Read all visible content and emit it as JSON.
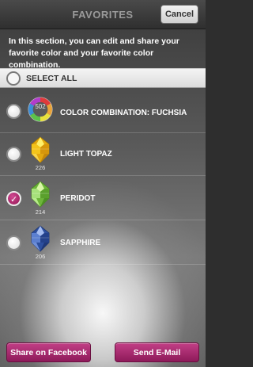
{
  "header": {
    "title": "FAVORITES",
    "cancel_label": "Cancel"
  },
  "intro_text": "In this section, you can edit and share your favorite color and your favorite color combination.",
  "select_all_label": "SELECT ALL",
  "items": [
    {
      "label": "COLOR COMBINATION: FUCHSIA",
      "code": "502",
      "checked": false,
      "icon": "color-wheel-icon"
    },
    {
      "label": "LIGHT TOPAZ",
      "code": "226",
      "checked": false,
      "icon": "crystal-bead-icon",
      "color": "#f2c21a"
    },
    {
      "label": "PERIDOT",
      "code": "214",
      "checked": true,
      "icon": "crystal-bead-icon",
      "color": "#8fce4a"
    },
    {
      "label": "SAPPHIRE",
      "code": "206",
      "checked": false,
      "icon": "crystal-bead-icon",
      "color": "#3b5fb8"
    }
  ],
  "buttons": {
    "facebook_label": "Share on Facebook",
    "email_label": "Send E-Mail"
  },
  "colors": {
    "accent": "#a8246c",
    "checked": "#b3306f"
  }
}
